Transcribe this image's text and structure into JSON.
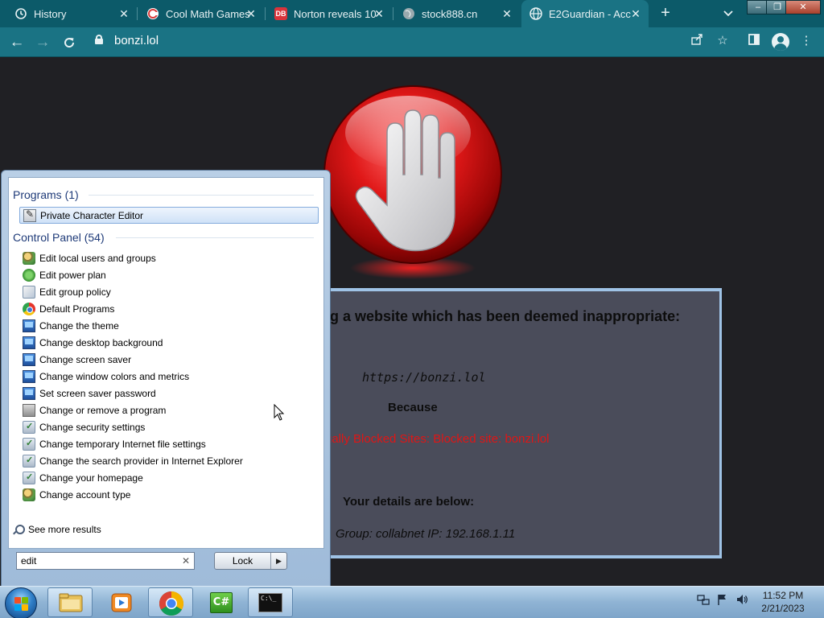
{
  "browser": {
    "tabs": [
      {
        "title": "History",
        "icon": "history-icon",
        "active": false
      },
      {
        "title": "Cool Math Games",
        "icon": "coolmath-favicon",
        "active": false
      },
      {
        "title": "Norton reveals 10",
        "icon": "db-favicon",
        "favicon_text": "DB",
        "active": false
      },
      {
        "title": "stock888.cn",
        "icon": "globe-icon",
        "active": false
      },
      {
        "title": "E2Guardian - Acc",
        "icon": "globe-icon",
        "active": true
      }
    ],
    "url": "bonzi.lol",
    "colors": {
      "frame": "#0c5a69",
      "toolbar": "#1a7384"
    }
  },
  "block_page": {
    "heading": "g a website which has been deemed inappropriate:",
    "blocked_url": "https://bonzi.lol",
    "because_label": "Because",
    "reason": "ually Blocked Sites:  Blocked site: bonzi.lol",
    "details_heading": "Your details are below:",
    "group_line": "Group: collabnet   IP: 192.168.1.11",
    "colors": {
      "reason": "#e01515",
      "panel": "#4a4c5a",
      "panel_border": "#9fc3e6"
    }
  },
  "start_menu": {
    "programs_header": "Programs (1)",
    "programs": [
      {
        "label": "Private Character Editor",
        "icon": "character-editor-icon",
        "selected": true
      }
    ],
    "control_panel_header": "Control Panel (54)",
    "control_panel": [
      {
        "label": "Edit local users and groups",
        "icon": "users-icon"
      },
      {
        "label": "Edit power plan",
        "icon": "power-plan-icon"
      },
      {
        "label": "Edit group policy",
        "icon": "group-policy-icon"
      },
      {
        "label": "Default Programs",
        "icon": "default-programs-icon"
      },
      {
        "label": "Change the theme",
        "icon": "display-icon"
      },
      {
        "label": "Change desktop background",
        "icon": "display-icon"
      },
      {
        "label": "Change screen saver",
        "icon": "display-icon"
      },
      {
        "label": "Change window colors and metrics",
        "icon": "display-icon"
      },
      {
        "label": "Set screen saver password",
        "icon": "display-icon"
      },
      {
        "label": "Change or remove a program",
        "icon": "programs-icon"
      },
      {
        "label": "Change security settings",
        "icon": "internet-options-icon"
      },
      {
        "label": "Change temporary Internet file settings",
        "icon": "internet-options-icon"
      },
      {
        "label": "Change the search provider in Internet Explorer",
        "icon": "internet-options-icon"
      },
      {
        "label": "Change your homepage",
        "icon": "internet-options-icon"
      },
      {
        "label": "Change account type",
        "icon": "users-icon"
      }
    ],
    "see_more": "See more results",
    "search_value": "edit",
    "lock_label": "Lock",
    "lock_menu_icon": "triangle-right-icon"
  },
  "taskbar": {
    "pinned": [
      {
        "name": "file-explorer-icon"
      },
      {
        "name": "media-player-icon"
      },
      {
        "name": "chrome-icon"
      },
      {
        "name": "csharp-icon",
        "text": "C#"
      },
      {
        "name": "command-prompt-icon",
        "text": "C:\\_"
      }
    ],
    "time": "11:52 PM",
    "date": "2/21/2023"
  }
}
